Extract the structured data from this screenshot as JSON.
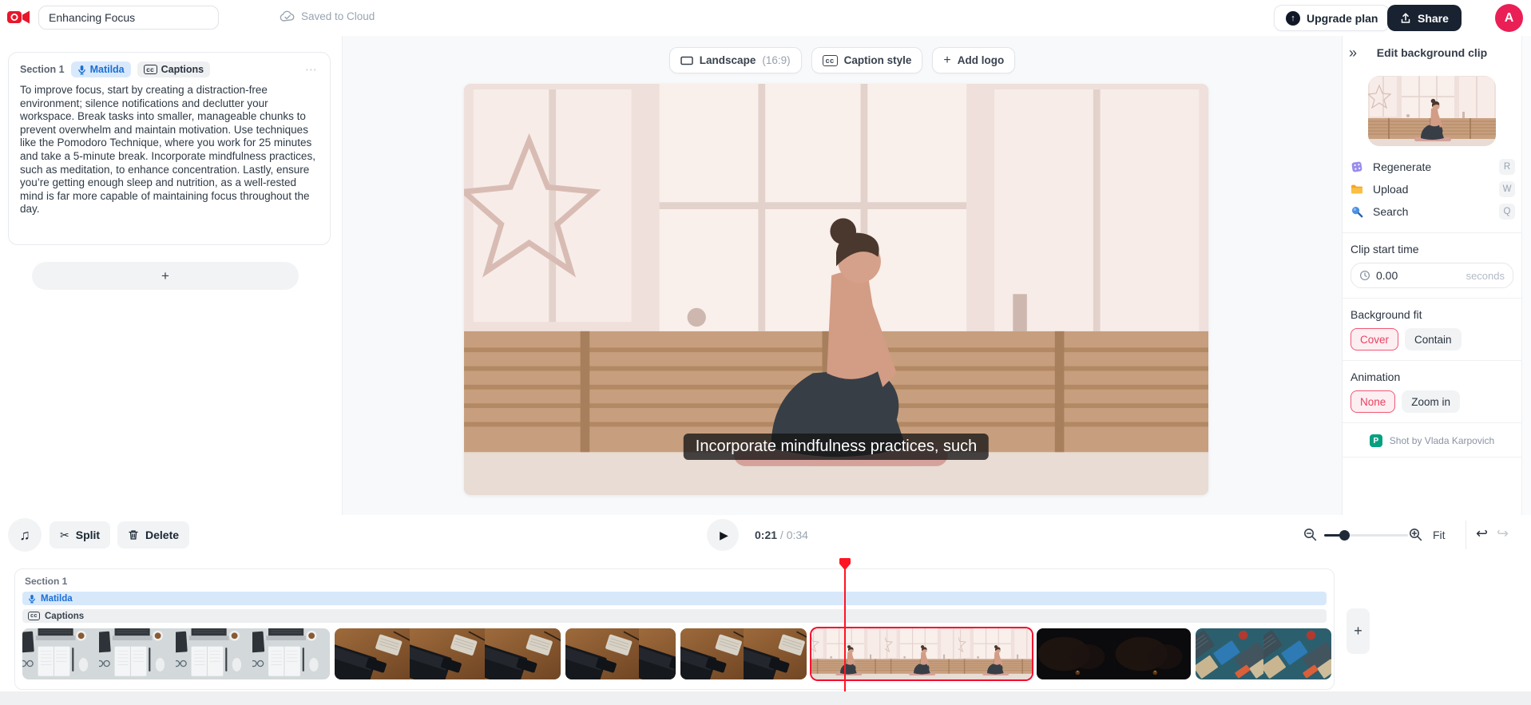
{
  "topbar": {
    "title_value": "Enhancing Focus",
    "saved_status": "Saved to Cloud",
    "upgrade_label": "Upgrade plan",
    "share_label": "Share",
    "avatar_initial": "A"
  },
  "left_panel": {
    "section_label": "Section 1",
    "voice_badge": "Matilda",
    "captions_badge": "Captions",
    "script_text": "To improve focus, start by creating a distraction-free environment; silence notifications and declutter your workspace. Break tasks into smaller, manageable chunks to prevent overwhelm and maintain motivation. Use techniques like the Pomodoro Technique, where you work for 25 minutes and take a 5-minute break. Incorporate mindfulness practices, such as meditation, to enhance concentration. Lastly, ensure you’re getting enough sleep and nutrition, as a well-rested mind is far more capable of maintaining focus throughout the day."
  },
  "canvas": {
    "aspect_label": "Landscape",
    "aspect_ratio": "(16:9)",
    "caption_style_button": "Caption style",
    "add_logo_button": "Add logo",
    "caption_overlay": "Incorporate mindfulness practices, such"
  },
  "right_panel": {
    "title": "Edit background clip",
    "actions": [
      {
        "label": "Regenerate",
        "shortcut": "R",
        "icon": "dice-icon"
      },
      {
        "label": "Upload",
        "shortcut": "W",
        "icon": "folder-icon"
      },
      {
        "label": "Search",
        "shortcut": "Q",
        "icon": "magnifier-icon"
      }
    ],
    "clip_start_label": "Clip start time",
    "clip_start_value": "0.00",
    "clip_start_unit": "seconds",
    "background_fit_label": "Background fit",
    "background_fit_options": {
      "cover": "Cover",
      "contain": "Contain"
    },
    "background_fit_selected": "Cover",
    "animation_label": "Animation",
    "animation_options": {
      "none": "None",
      "zoom_in": "Zoom in"
    },
    "animation_selected": "None",
    "credit": "Shot by Vlada Karpovich"
  },
  "transport": {
    "split_label": "Split",
    "delete_label": "Delete",
    "current_time": "0:21",
    "time_rest": " / 0:34",
    "fit_label": "Fit"
  },
  "timeline": {
    "section_label": "Section 1",
    "voice_track": "Matilda",
    "captions_track": "Captions"
  },
  "icons": {
    "ellipsis": "⋯",
    "plus": "+",
    "collapse": "»",
    "up_arrow": "↑",
    "music_note": "♫",
    "scissors": "✂",
    "play": "▶",
    "undo": "↩",
    "redo": "↪",
    "cc": "cc",
    "pexels_glyph": "P"
  },
  "colors": {
    "accent_red": "#ef4056",
    "playhead_red": "#ff1422",
    "logo_red": "#e8172c",
    "avatar_pink": "#e91f56",
    "voice_blue": "#1a6fd4",
    "dark_button": "#182230"
  }
}
